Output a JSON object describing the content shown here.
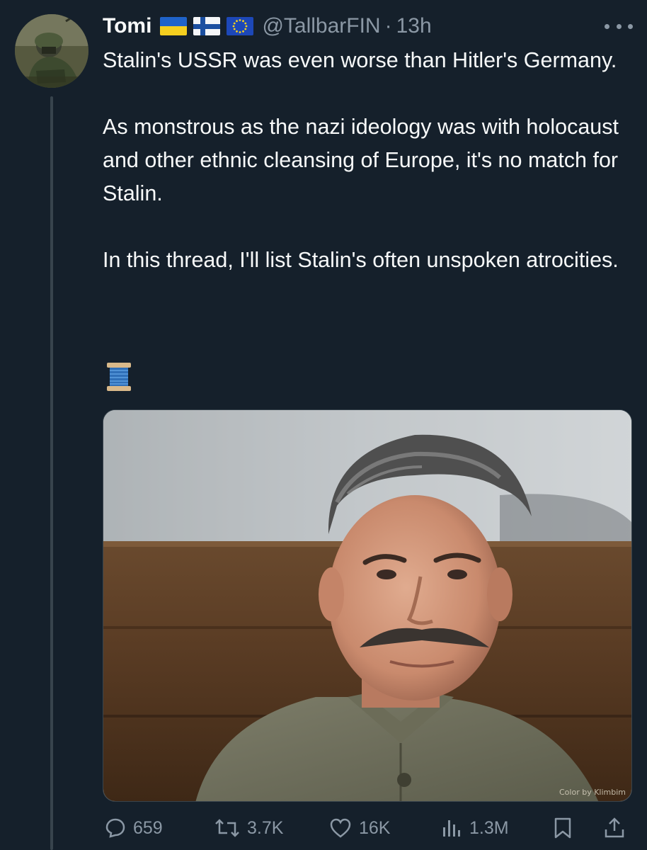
{
  "post": {
    "author_name": "Tomi",
    "flags": [
      "ukraine-flag-icon",
      "finland-flag-icon",
      "eu-flag-icon"
    ],
    "handle": "@TallbarFIN",
    "separator": "·",
    "time": "13h",
    "paragraphs": [
      "Stalin's USSR was even worse than Hitler's Germany.",
      "As monstrous as the nazi ideology was with holocaust and other ethnic cleansing of Europe, it's no match for Stalin.",
      "In this thread, I'll list Stalin's often unspoken atrocities."
    ],
    "emoji": "spool-of-thread-icon",
    "image_credit": "Color by Klimbim"
  },
  "actions": {
    "replies": "659",
    "reposts": "3.7K",
    "likes": "16K",
    "views": "1.3M"
  },
  "colors": {
    "background": "#15202b",
    "text": "#f7f9f9",
    "secondary": "#8b98a5",
    "divider": "#38444d"
  }
}
